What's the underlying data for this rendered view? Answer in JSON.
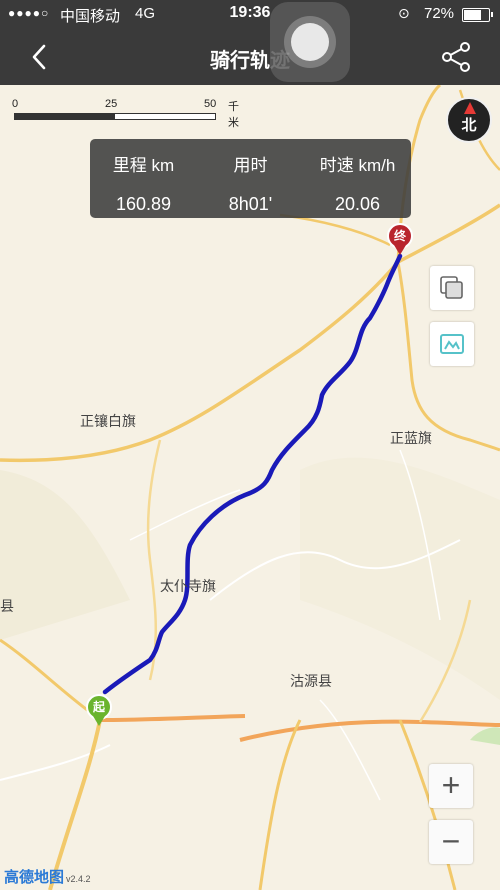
{
  "status_bar": {
    "signal": "●●●●○",
    "carrier": "中国移动",
    "network": "4G",
    "time": "19:36",
    "orientation_lock": "⊙",
    "battery": "72%",
    "battery_level": 0.72
  },
  "nav": {
    "title": "骑行轨迹",
    "back_icon": "chevron-left-icon",
    "share_icon": "share-icon"
  },
  "scale": {
    "ticks": [
      "0",
      "25",
      "50"
    ],
    "unit": "千米"
  },
  "compass": {
    "label": "北"
  },
  "stats": {
    "distance_label": "里程 km",
    "distance_value": "160.89",
    "duration_label": "用时",
    "duration_value": "8h01'",
    "speed_label": "时速 km/h",
    "speed_value": "20.06"
  },
  "map": {
    "places": [
      {
        "name": "正镶白旗"
      },
      {
        "name": "正蓝旗"
      },
      {
        "name": "太仆寺旗"
      },
      {
        "name": "沽源县"
      },
      {
        "name": "县"
      }
    ],
    "start_label": "起",
    "end_label": "终",
    "route_color": "#1a1ab8",
    "start_color": "#6ab42d",
    "end_color": "#b9252d"
  },
  "controls": {
    "zoom_in": "+",
    "zoom_out": "−",
    "layers_icon": "layers-icon",
    "traffic_icon": "traffic-icon"
  },
  "brand": {
    "name": "高德地图",
    "version": "v2.4.2"
  }
}
